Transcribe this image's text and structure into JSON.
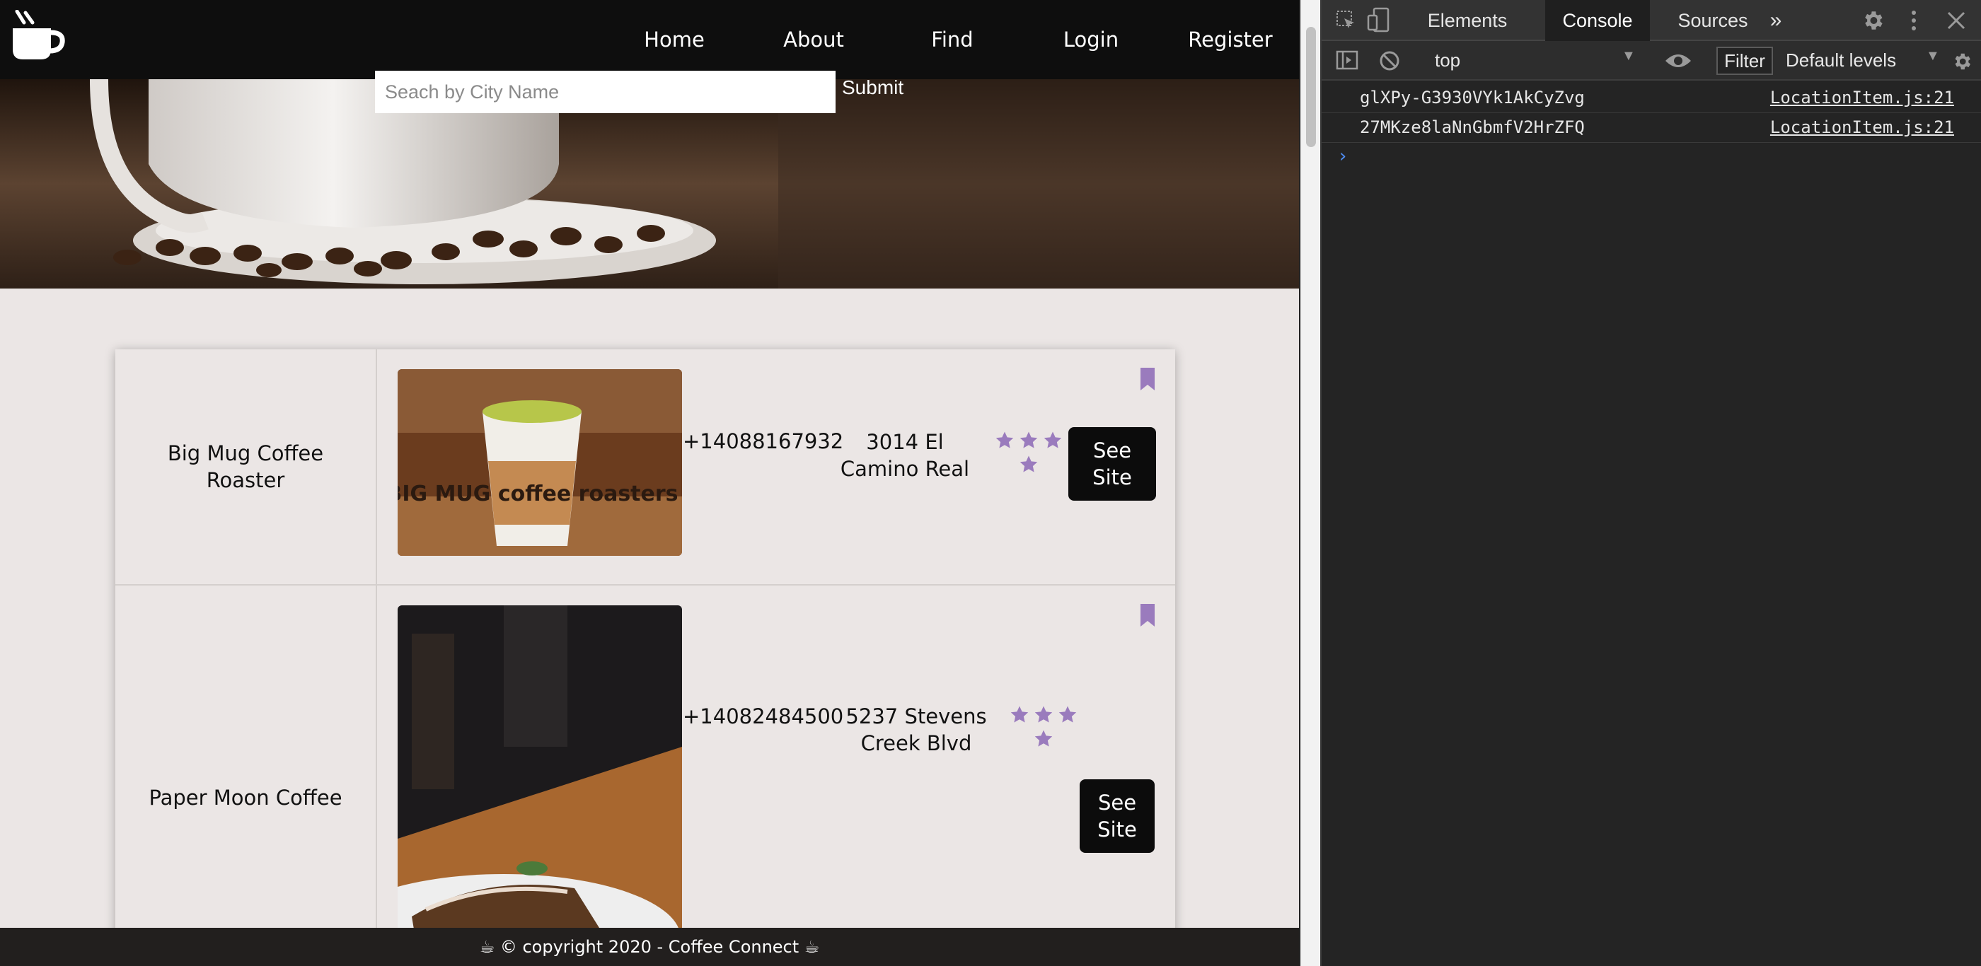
{
  "nav": {
    "links": [
      "Home",
      "About",
      "Find",
      "Login",
      "Register"
    ]
  },
  "search": {
    "placeholder": "Seach by City Name",
    "submit_label": "Submit"
  },
  "results": [
    {
      "name": "Big Mug Coffee Roaster",
      "phone": "+14088167932",
      "address": "3014 El Camino Real",
      "rating_stars": 4,
      "see_site_label": "See Site",
      "photo_label": "BIG MUG coffee roasters"
    },
    {
      "name": "Paper Moon Coffee",
      "phone": "+14082484500",
      "address": "5237 Stevens Creek Blvd",
      "rating_stars": 4,
      "see_site_label": "See Site"
    }
  ],
  "footer": {
    "text": "☕ © copyright 2020 - Coffee Connect ☕"
  },
  "devtools": {
    "tabs": [
      "Elements",
      "Console",
      "Sources"
    ],
    "active_tab": "Console",
    "context": "top",
    "filter_label": "Filter",
    "levels_label": "Default levels",
    "console_logs": [
      {
        "message": "glXPy-G3930VYk1AkCyZvg",
        "source": "LocationItem.js:21"
      },
      {
        "message": "27MKze8laNnGbmfV2HrZFQ",
        "source": "LocationItem.js:21"
      }
    ],
    "prompt": "›"
  },
  "colors": {
    "accent_star": "#9a7bbd",
    "nav_bg": "#0e0e0e",
    "page_bg": "#ebe6e5",
    "footer_bg": "#221f1e"
  }
}
